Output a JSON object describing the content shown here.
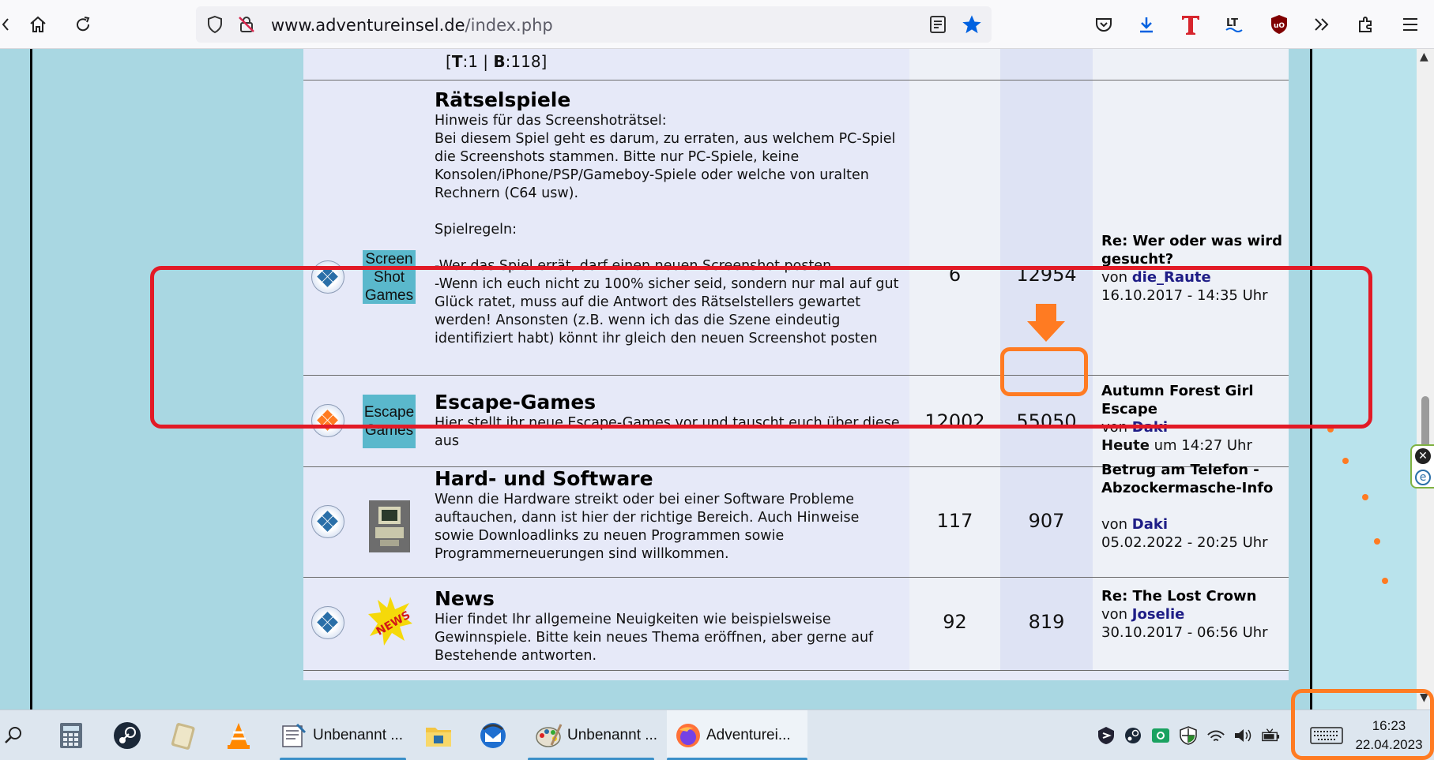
{
  "browser": {
    "url_domain": "www.adventureinsel.de",
    "url_path": "/index.php"
  },
  "forum": {
    "prev_row_stats": {
      "t_label": "T",
      "t_value": ":1 | ",
      "b_label": "B",
      "b_value": ":118]",
      "open_bracket": "["
    },
    "rows": [
      {
        "logo_text": "Screen Shot Games",
        "title": "Rätselspiele",
        "description": "Hinweis für das Screenshoträtsel:\nBei diesem Spiel geht es darum, zu erraten, aus welchem PC-Spiel die Screenshots stammen. Bitte nur PC-Spiele, keine Konsolen/iPhone/PSP/Gameboy-Spiele oder welche von uralten Rechnern (C64 usw).\n\nSpielregeln:\n\n-Wer das Spiel errät, darf einen neuen Screenshot posten\n-Wenn ich euch nicht zu 100% sicher seid, sondern nur mal auf gut Glück ratet, muss auf die Antwort des Rätselstellers gewartet werden! Ansonsten (z.B. wenn ich das die Szene eindeutig identifiziert habt) könnt ihr gleich den neuen Screenshot posten",
        "topics": "6",
        "posts": "12954",
        "last_title": "Re: Wer oder was wird gesucht?",
        "last_by": "von ",
        "last_user": "die_Raute",
        "last_date": "16.10.2017 - 14:35 Uhr"
      },
      {
        "logo_text": "Escape Games",
        "title": "Escape-Games",
        "description": "Hier stellt ihr neue Escape-Games vor und tauscht euch über diese aus",
        "topics": "12002",
        "posts": "55050",
        "last_title": "Autumn Forest Girl Escape",
        "last_by": "von ",
        "last_user": "Daki",
        "last_date_bold": "Heute",
        "last_date": " um 14:27 Uhr"
      },
      {
        "title": "Hard- und Software",
        "description": "Wenn die Hardware streikt oder bei einer Software Probleme auftauchen, dann ist hier der richtige Bereich. Auch Hinweise sowie Downloadlinks zu neuen Programmen sowie Programmerneuerungen sind willkommen.",
        "topics": "117",
        "posts": "907",
        "last_title": "Betrug am Telefon - Abzockermasche-Info",
        "last_by": "von ",
        "last_user": "Daki",
        "last_date": "05.02.2022 - 20:25 Uhr"
      },
      {
        "title": "News",
        "description": "Hier findet Ihr allgemeine Neuigkeiten wie beispielsweise Gewinnspiele. Bitte kein neues Thema eröffnen, aber gerne auf Bestehende antworten.",
        "topics": "92",
        "posts": "819",
        "last_title": "Re: The Lost Crown",
        "last_by": "von ",
        "last_user": "Joselie",
        "last_date": "30.10.2017 - 06:56 Uhr"
      }
    ]
  },
  "taskbar": {
    "apps": [
      {
        "label": "Unbenannt ..."
      },
      {
        "label": "Unbenannt ..."
      },
      {
        "label": "Adventurei..."
      }
    ],
    "clock_time": "16:23",
    "clock_date": "22.04.2023"
  },
  "colors": {
    "page_bg": "#a9d7e2",
    "forum_bg": "#e6e9f8",
    "user_link": "#1e1d86",
    "annotation_red": "#e21a26",
    "annotation_orange": "#ff7b22"
  }
}
